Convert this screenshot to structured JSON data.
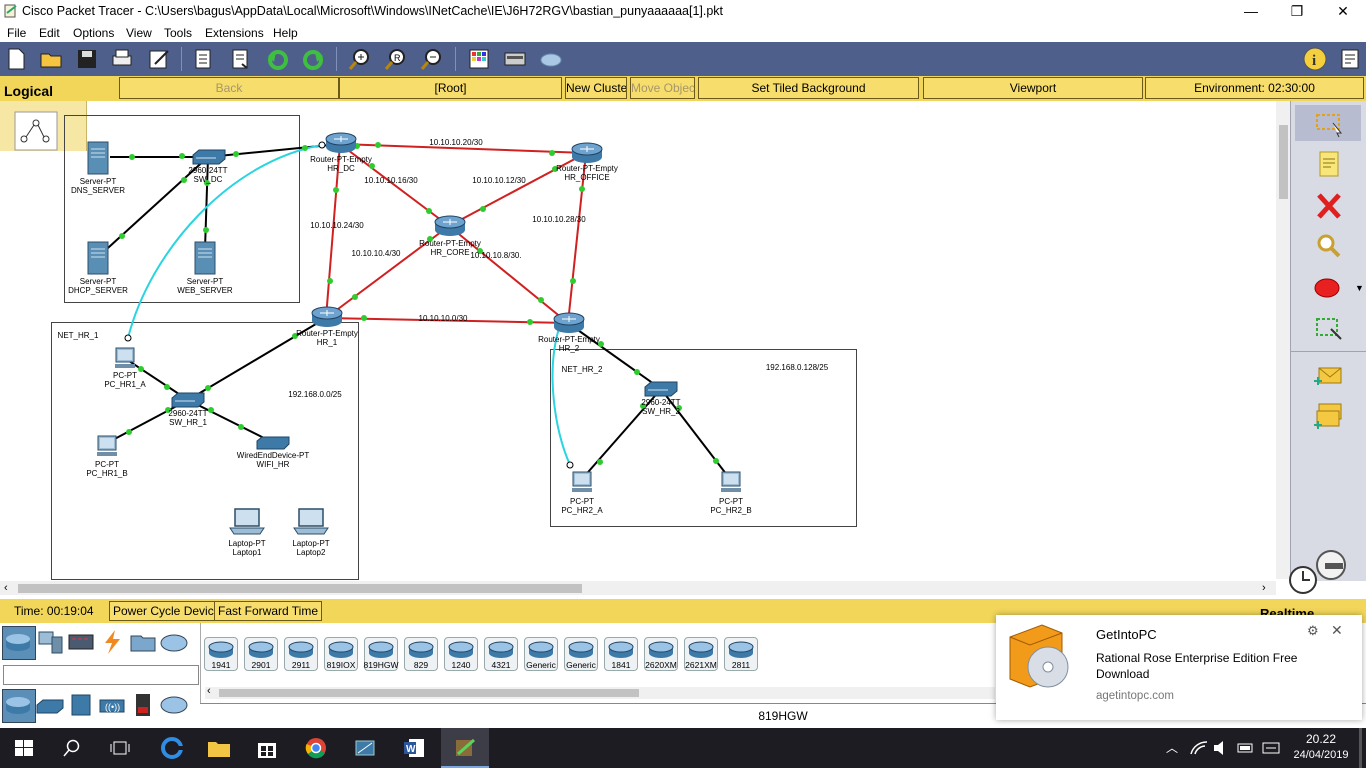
{
  "window": {
    "title": "Cisco Packet Tracer - C:\\Users\\bagus\\AppData\\Local\\Microsoft\\Windows\\INetCache\\IE\\J6H72RGV\\bastian_punyaaaaaa[1].pkt",
    "minimize": "—",
    "maximize": "❐",
    "close": "✕"
  },
  "menu": [
    "File",
    "Edit",
    "Options",
    "View",
    "Tools",
    "Extensions",
    "Help"
  ],
  "navbar": {
    "mode": "Logical",
    "back": "Back",
    "root": "[Root]",
    "new_cluster": "New Cluster",
    "move_object": "Move Object",
    "tiled_bg": "Set Tiled Background",
    "viewport": "Viewport",
    "environment": "Environment: 02:30:00"
  },
  "topology": {
    "devices": {
      "dns_server": [
        "Server-PT",
        "DNS_SERVER"
      ],
      "dhcp_server": [
        "Server-PT",
        "DHCP_SERVER"
      ],
      "web_server": [
        "Server-PT",
        "WEB_SERVER"
      ],
      "sw_dc": [
        "2960-24TT",
        "SW_DC"
      ],
      "hr_dc": [
        "Router-PT-Empty",
        "HR_DC"
      ],
      "hr_office": [
        "Router-PT-Empty",
        "HR_OFFICE"
      ],
      "hr_core": [
        "Router-PT-Empty",
        "HR_CORE"
      ],
      "hr_1": [
        "Router-PT-Empty",
        "HR_1"
      ],
      "hr_2": [
        "Router-PT-Empty",
        "HR_2"
      ],
      "sw_hr_1": [
        "2960-24TT",
        "SW_HR_1"
      ],
      "sw_hr_2": [
        "2960-24TT",
        "SW_HR_2"
      ],
      "pc_hr1_a": [
        "PC-PT",
        "PC_HR1_A"
      ],
      "pc_hr1_b": [
        "PC-PT",
        "PC_HR1_B"
      ],
      "wifi_hr": [
        "WiredEndDevice-PT",
        "WIFI_HR"
      ],
      "laptop1": [
        "Laptop-PT",
        "Laptop1"
      ],
      "laptop2": [
        "Laptop-PT",
        "Laptop2"
      ],
      "pc_hr2_a": [
        "PC-PT",
        "PC_HR2_A"
      ],
      "pc_hr2_b": [
        "PC-PT",
        "PC_HR2_B"
      ]
    },
    "networks": {
      "n1": "10.10.10.20/30",
      "n2": "10.10.10.16/30",
      "n3": "10.10.10.12/30",
      "n4": "10.10.10.24/30",
      "n5": "10.10.10.28/30",
      "n6": "10.10.10.4/30",
      "n7": "10.10.10.8/30.",
      "n8": "10.10.10.0/30",
      "lan1": "192.168.0.0/25",
      "lan2": "192.168.0.128/25"
    },
    "zones": {
      "net_hr_1": "NET_HR_1",
      "net_hr_2": "NET_HR_2"
    }
  },
  "status": {
    "time": "Time: 00:19:04",
    "power_cycle": "Power Cycle Devices",
    "fast_forward": "Fast Forward Time",
    "realtime": "Realtime"
  },
  "device_list": [
    "1941",
    "2901",
    "2911",
    "819IOX",
    "819HGW",
    "829",
    "1240",
    "4321",
    "Generic",
    "Generic",
    "1841",
    "2620XM",
    "2621XM",
    "2811"
  ],
  "selected_device": "819HGW",
  "toast": {
    "app": "GetIntoPC",
    "message": "Rational Rose Enterprise Edition Free Download",
    "source": "agetintopc.com"
  },
  "clock": {
    "time": "20.22",
    "date": "24/04/2019"
  },
  "colors": {
    "toolbar": "#4f5f8c",
    "navbar": "#f2d65a",
    "serial_link": "#d02020",
    "ethernet_link": "#000000",
    "console_link": "#2ad4e0",
    "port_up": "#2ecc2e"
  }
}
